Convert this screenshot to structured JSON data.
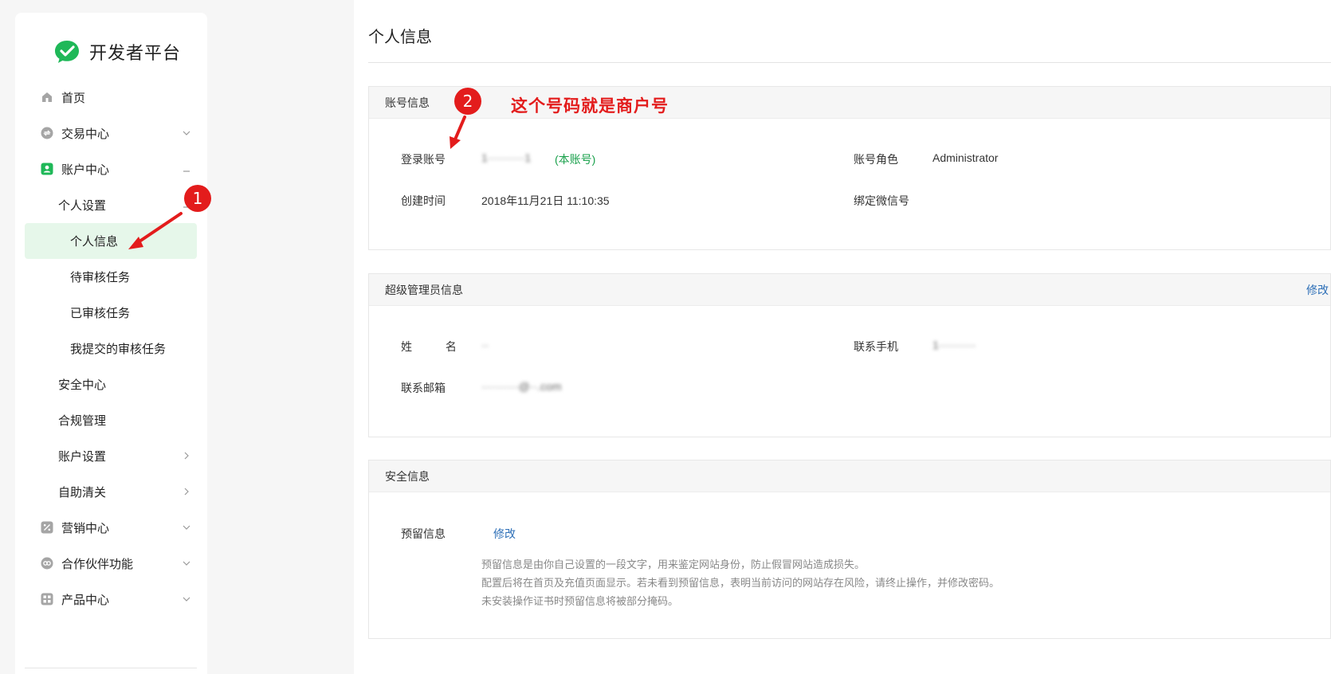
{
  "sidebar": {
    "logo_text": "开发者平台",
    "items": [
      {
        "label": "首页",
        "icon": "home-icon"
      },
      {
        "label": "交易中心",
        "icon": "exchange-icon"
      },
      {
        "label": "账户中心",
        "icon": "account-icon"
      },
      {
        "label": "个人设置"
      },
      {
        "label": "个人信息"
      },
      {
        "label": "待审核任务"
      },
      {
        "label": "已审核任务"
      },
      {
        "label": "我提交的审核任务"
      },
      {
        "label": "安全中心"
      },
      {
        "label": "合规管理"
      },
      {
        "label": "账户设置"
      },
      {
        "label": "自助清关"
      },
      {
        "label": "营销中心",
        "icon": "marketing-icon"
      },
      {
        "label": "合作伙伴功能",
        "icon": "partner-icon"
      },
      {
        "label": "产品中心",
        "icon": "product-icon"
      }
    ]
  },
  "main": {
    "title": "个人信息",
    "account": {
      "header": "账号信息",
      "login_label": "登录账号",
      "login_value": "1··········1",
      "login_note": "(本账号)",
      "role_label": "账号角色",
      "role_value": "Administrator",
      "created_label": "创建时间",
      "created_value": "2018年11月21日 11:10:35",
      "wechat_label": "绑定微信号"
    },
    "admin": {
      "header": "超级管理员信息",
      "edit": "修改",
      "name_label": "姓 名",
      "name_value": "··",
      "phone_label": "联系手机",
      "phone_value": "1··········",
      "email_label": "联系邮箱",
      "email_value": "··········@··.com"
    },
    "security": {
      "header": "安全信息",
      "reserved_label": "预留信息",
      "reserved_edit": "修改",
      "desc_lines": [
        "预留信息是由你自己设置的一段文字，用来鉴定网站身份，防止假冒网站造成损失。",
        "配置后将在首页及充值页面显示。若未看到预留信息，表明当前访问的网站存在风险，请终止操作，并修改密码。",
        "未安装操作证书时预留信息将被部分掩码。"
      ]
    }
  },
  "annotations": {
    "badge1": "1",
    "badge2": "2",
    "note": "这个号码就是商户号"
  },
  "colors": {
    "brand_green": "#19a04b",
    "active_bg": "#e6f7ea",
    "annotation_red": "#e31c1c",
    "link_blue": "#2d6fb7"
  }
}
